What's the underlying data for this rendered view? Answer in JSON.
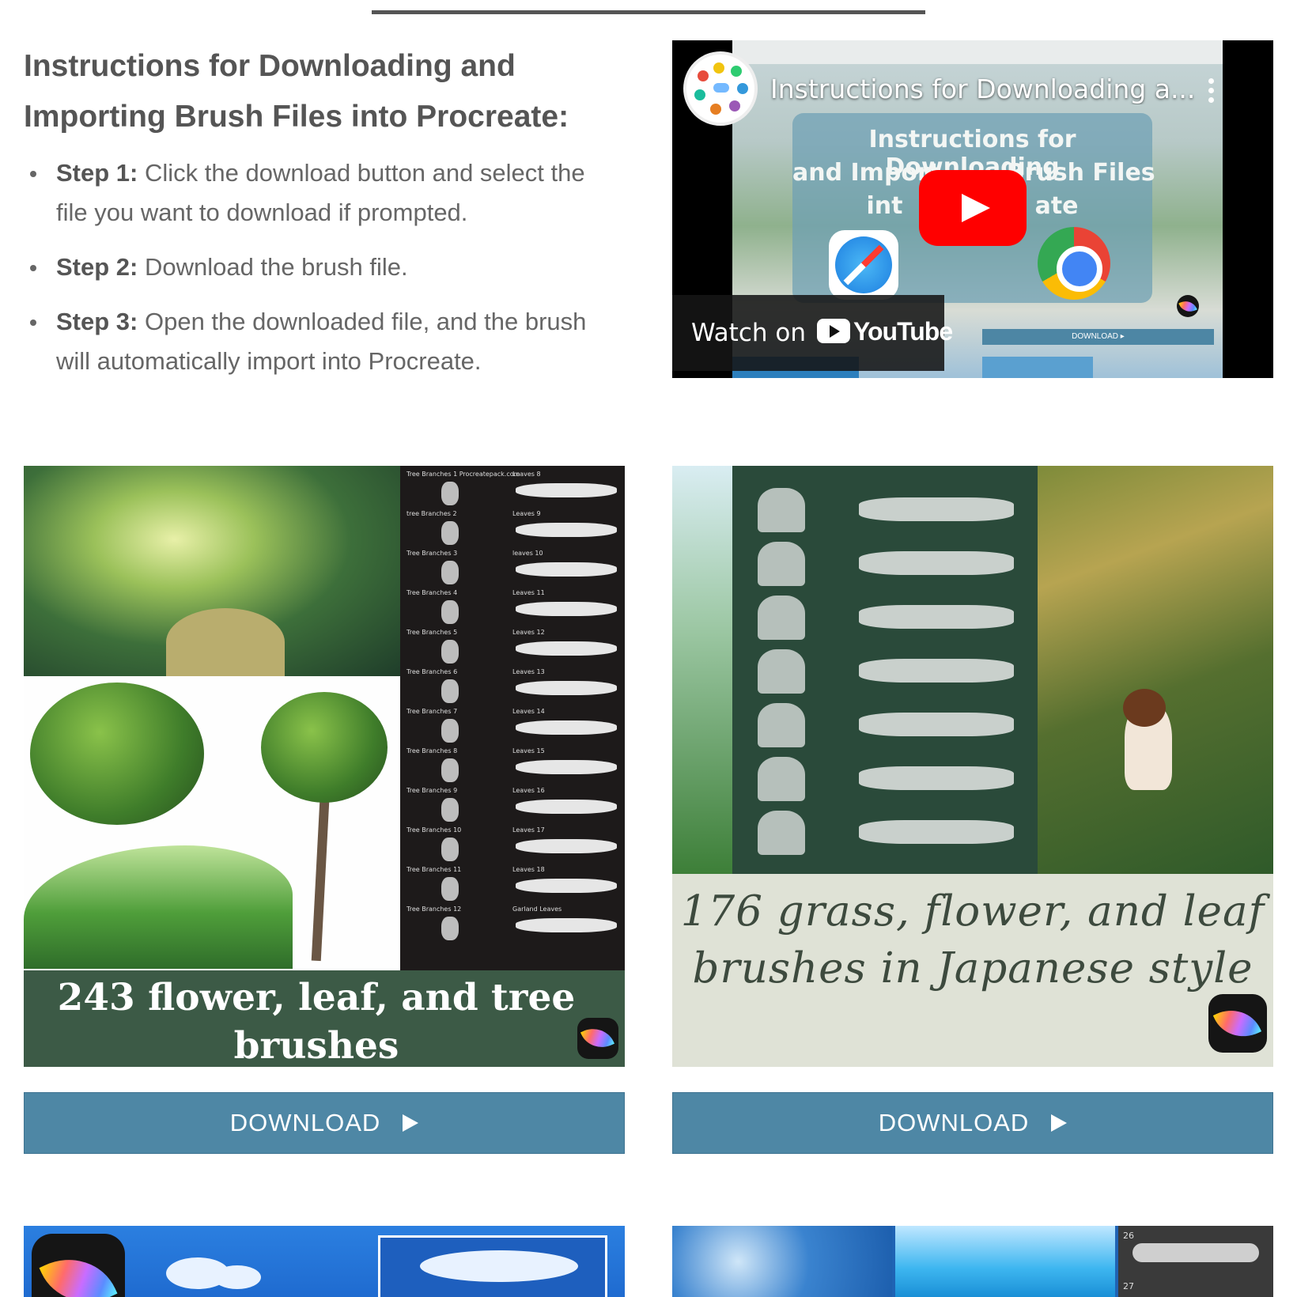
{
  "instructions": {
    "heading": "Instructions for Downloading and Importing Brush Files into Procreate:",
    "steps": [
      {
        "label": "Step 1:",
        "text": "Click the download button and select the file you want to download if prompted."
      },
      {
        "label": "Step 2:",
        "text": "Download the brush file."
      },
      {
        "label": "Step 3:",
        "text": "Open the downloaded file, and the brush will automatically import into Procreate."
      }
    ]
  },
  "video": {
    "title": "Instructions for Downloading a...",
    "card_line1": "Instructions for Downloading",
    "card_line2": "and Import        Brush Files",
    "card_line3": "int                ate",
    "watch_label": "Watch on",
    "youtube_word": "YouTube",
    "thumb_download": "DOWNLOAD ▸",
    "icons": [
      "channel-logo-icon",
      "play-icon",
      "safari-icon",
      "chrome-icon",
      "youtube-icon",
      "more-options-icon"
    ]
  },
  "products": [
    {
      "caption": "243 flower, leaf, and tree brushes",
      "button_label": "DOWNLOAD",
      "panel_labels": [
        "Tree Branches 1 Procreatepack.com",
        "tree Branches 2",
        "Tree Branches 3",
        "Tree Branches 4",
        "Tree Branches 5",
        "Tree Branches 6",
        "Tree Branches 7",
        "Tree Branches 8",
        "Tree Branches 9",
        "Tree Branches 10",
        "Tree Branches 11",
        "Tree Branches 12"
      ],
      "panel_labels_right": [
        "Leaves 8",
        "Leaves 9",
        "leaves 10",
        "Leaves 11",
        "Leaves 12",
        "Leaves 13",
        "Leaves 14",
        "Leaves 15",
        "Leaves 16",
        "Leaves 17",
        "Leaves 18",
        "Garland Leaves"
      ]
    },
    {
      "caption": "176 grass, flower, and leaf brushes in Japanese style",
      "button_label": "DOWNLOAD"
    }
  ],
  "more_products": {
    "numbers": [
      "26",
      "27"
    ]
  },
  "colors": {
    "button": "#4e87a5",
    "heading": "#555555",
    "banner_green": "#3c5a46",
    "youtube_red": "#ff0000"
  }
}
